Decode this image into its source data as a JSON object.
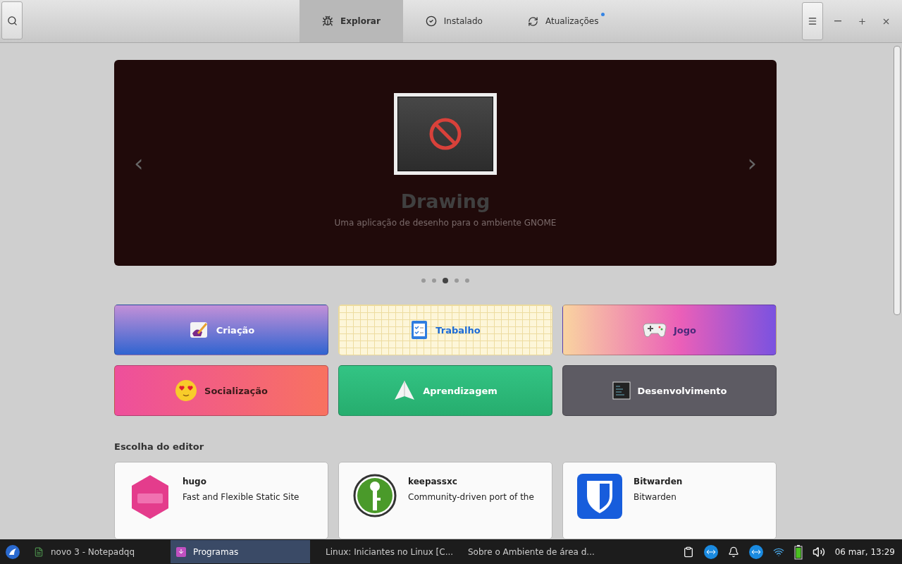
{
  "header": {
    "tabs": [
      {
        "label": "Explorar",
        "selected": true,
        "kind": "explore",
        "badge": false
      },
      {
        "label": "Instalado",
        "selected": false,
        "kind": "installed",
        "badge": false
      },
      {
        "label": "Atualizações",
        "selected": false,
        "kind": "updates",
        "badge": true
      }
    ]
  },
  "banner": {
    "title": "Drawing",
    "subtitle": "Uma aplicação de desenho para o ambiente GNOME",
    "prev": "‹",
    "next": "›",
    "dots": [
      {
        "selected": false
      },
      {
        "selected": false
      },
      {
        "selected": true
      },
      {
        "selected": false
      },
      {
        "selected": false
      }
    ]
  },
  "categories": [
    {
      "label": "Criação",
      "kind": "creation"
    },
    {
      "label": "Trabalho",
      "kind": "work"
    },
    {
      "label": "Jogo",
      "kind": "games"
    },
    {
      "label": "Socialização",
      "kind": "social"
    },
    {
      "label": "Aprendizagem",
      "kind": "learning"
    },
    {
      "label": "Desenvolvimento",
      "kind": "development"
    }
  ],
  "editors_choice": {
    "title": "Escolha do editor",
    "apps": [
      {
        "name": "hugo",
        "description": "Fast and Flexible Static Site",
        "kind": "hugo"
      },
      {
        "name": "keepassxc",
        "description": "Community-driven port of the",
        "kind": "keepass"
      },
      {
        "name": "Bitwarden",
        "description": "Bitwarden",
        "kind": "bitwarden"
      }
    ]
  },
  "taskbar": {
    "windows": [
      {
        "label": "novo 3 - Notepadqq",
        "selected": false,
        "kind": "editor"
      },
      {
        "label": "Programas",
        "selected": true,
        "kind": "store"
      },
      {
        "label": "Linux: Iniciantes no Linux [C...",
        "selected": false,
        "kind": "browser"
      },
      {
        "label": "Sobre o Ambiente de área d...",
        "selected": false,
        "kind": "star"
      }
    ],
    "clock": "06 mar, 13:29"
  }
}
